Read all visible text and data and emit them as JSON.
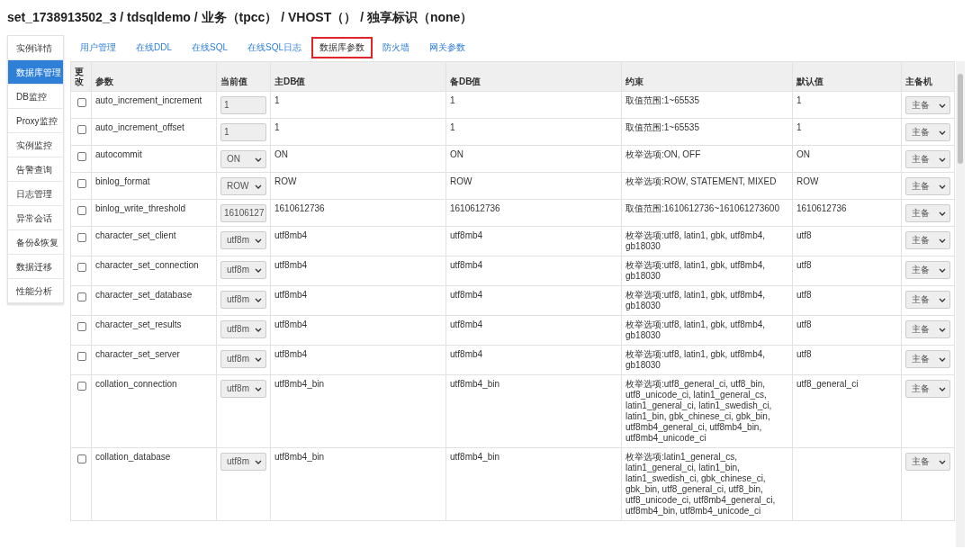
{
  "title": "set_1738913502_3 / tdsqldemo / 业务（tpcc） / VHOST（） / 独享标识（none）",
  "sidebar": {
    "items": [
      {
        "label": "实例详情",
        "selected": false
      },
      {
        "label": "数据库管理",
        "selected": true
      },
      {
        "label": "DB监控",
        "selected": false
      },
      {
        "label": "Proxy监控",
        "selected": false
      },
      {
        "label": "实例监控",
        "selected": false
      },
      {
        "label": "告警查询",
        "selected": false
      },
      {
        "label": "日志管理",
        "selected": false
      },
      {
        "label": "异常会话",
        "selected": false
      },
      {
        "label": "备份&恢复",
        "selected": false
      },
      {
        "label": "数据迁移",
        "selected": false
      },
      {
        "label": "性能分析",
        "selected": false
      }
    ]
  },
  "tabs": [
    {
      "label": "用户管理",
      "selected": false
    },
    {
      "label": "在线DDL",
      "selected": false
    },
    {
      "label": "在线SQL",
      "selected": false
    },
    {
      "label": "在线SQL日志",
      "selected": false
    },
    {
      "label": "数据库参数",
      "selected": true
    },
    {
      "label": "防火墙",
      "selected": false
    },
    {
      "label": "网关参数",
      "selected": false
    }
  ],
  "table": {
    "columns": [
      "更改",
      "参数",
      "当前值",
      "主DB值",
      "备DB值",
      "约束",
      "默认值",
      "主备机"
    ],
    "rows": [
      {
        "checked": false,
        "name": "auto_increment_increment",
        "current": {
          "kind": "input",
          "value": "1"
        },
        "master": "1",
        "slave": "1",
        "constraint": "取值范围:1~65535",
        "default": "1",
        "host": "主备"
      },
      {
        "checked": false,
        "name": "auto_increment_offset",
        "current": {
          "kind": "input",
          "value": "1"
        },
        "master": "1",
        "slave": "1",
        "constraint": "取值范围:1~65535",
        "default": "1",
        "host": "主备"
      },
      {
        "checked": false,
        "name": "autocommit",
        "current": {
          "kind": "select",
          "value": "ON"
        },
        "master": "ON",
        "slave": "ON",
        "constraint": "枚举选项:ON, OFF",
        "default": "ON",
        "host": "主备"
      },
      {
        "checked": false,
        "name": "binlog_format",
        "current": {
          "kind": "select",
          "value": "ROW"
        },
        "master": "ROW",
        "slave": "ROW",
        "constraint": "枚举选项:ROW, STATEMENT, MIXED",
        "default": "ROW",
        "host": "主备"
      },
      {
        "checked": false,
        "name": "binlog_write_threshold",
        "current": {
          "kind": "input",
          "value": "16106127"
        },
        "master": "1610612736",
        "slave": "1610612736",
        "constraint": "取值范围:1610612736~161061273600",
        "default": "1610612736",
        "host": "主备"
      },
      {
        "checked": false,
        "name": "character_set_client",
        "current": {
          "kind": "select",
          "value": "utf8m"
        },
        "master": "utf8mb4",
        "slave": "utf8mb4",
        "constraint": "枚举选项:utf8, latin1, gbk, utf8mb4, gb18030",
        "default": "utf8",
        "host": "主备"
      },
      {
        "checked": false,
        "name": "character_set_connection",
        "current": {
          "kind": "select",
          "value": "utf8m"
        },
        "master": "utf8mb4",
        "slave": "utf8mb4",
        "constraint": "枚举选项:utf8, latin1, gbk, utf8mb4, gb18030",
        "default": "utf8",
        "host": "主备"
      },
      {
        "checked": false,
        "name": "character_set_database",
        "current": {
          "kind": "select",
          "value": "utf8m"
        },
        "master": "utf8mb4",
        "slave": "utf8mb4",
        "constraint": "枚举选项:utf8, latin1, gbk, utf8mb4, gb18030",
        "default": "utf8",
        "host": "主备"
      },
      {
        "checked": false,
        "name": "character_set_results",
        "current": {
          "kind": "select",
          "value": "utf8m"
        },
        "master": "utf8mb4",
        "slave": "utf8mb4",
        "constraint": "枚举选项:utf8, latin1, gbk, utf8mb4, gb18030",
        "default": "utf8",
        "host": "主备"
      },
      {
        "checked": false,
        "name": "character_set_server",
        "current": {
          "kind": "select",
          "value": "utf8m"
        },
        "master": "utf8mb4",
        "slave": "utf8mb4",
        "constraint": "枚举选项:utf8, latin1, gbk, utf8mb4, gb18030",
        "default": "utf8",
        "host": "主备"
      },
      {
        "checked": false,
        "name": "collation_connection",
        "current": {
          "kind": "select",
          "value": "utf8m"
        },
        "master": "utf8mb4_bin",
        "slave": "utf8mb4_bin",
        "constraint": "枚举选项:utf8_general_ci, utf8_bin, utf8_unicode_ci, latin1_general_cs, latin1_general_ci, latin1_swedish_ci, latin1_bin, gbk_chinese_ci, gbk_bin, utf8mb4_general_ci, utf8mb4_bin, utf8mb4_unicode_ci",
        "default": "utf8_general_ci",
        "host": "主备"
      },
      {
        "checked": false,
        "name": "collation_database",
        "current": {
          "kind": "select",
          "value": "utf8m"
        },
        "master": "utf8mb4_bin",
        "slave": "utf8mb4_bin",
        "constraint": "枚举选项:latin1_general_cs, latin1_general_ci, latin1_bin, latin1_swedish_ci, gbk_chinese_ci, gbk_bin, utf8_general_ci, utf8_bin, utf8_unicode_ci, utf8mb4_general_ci, utf8mb4_bin, utf8mb4_unicode_ci",
        "host": "主备"
      }
    ]
  }
}
